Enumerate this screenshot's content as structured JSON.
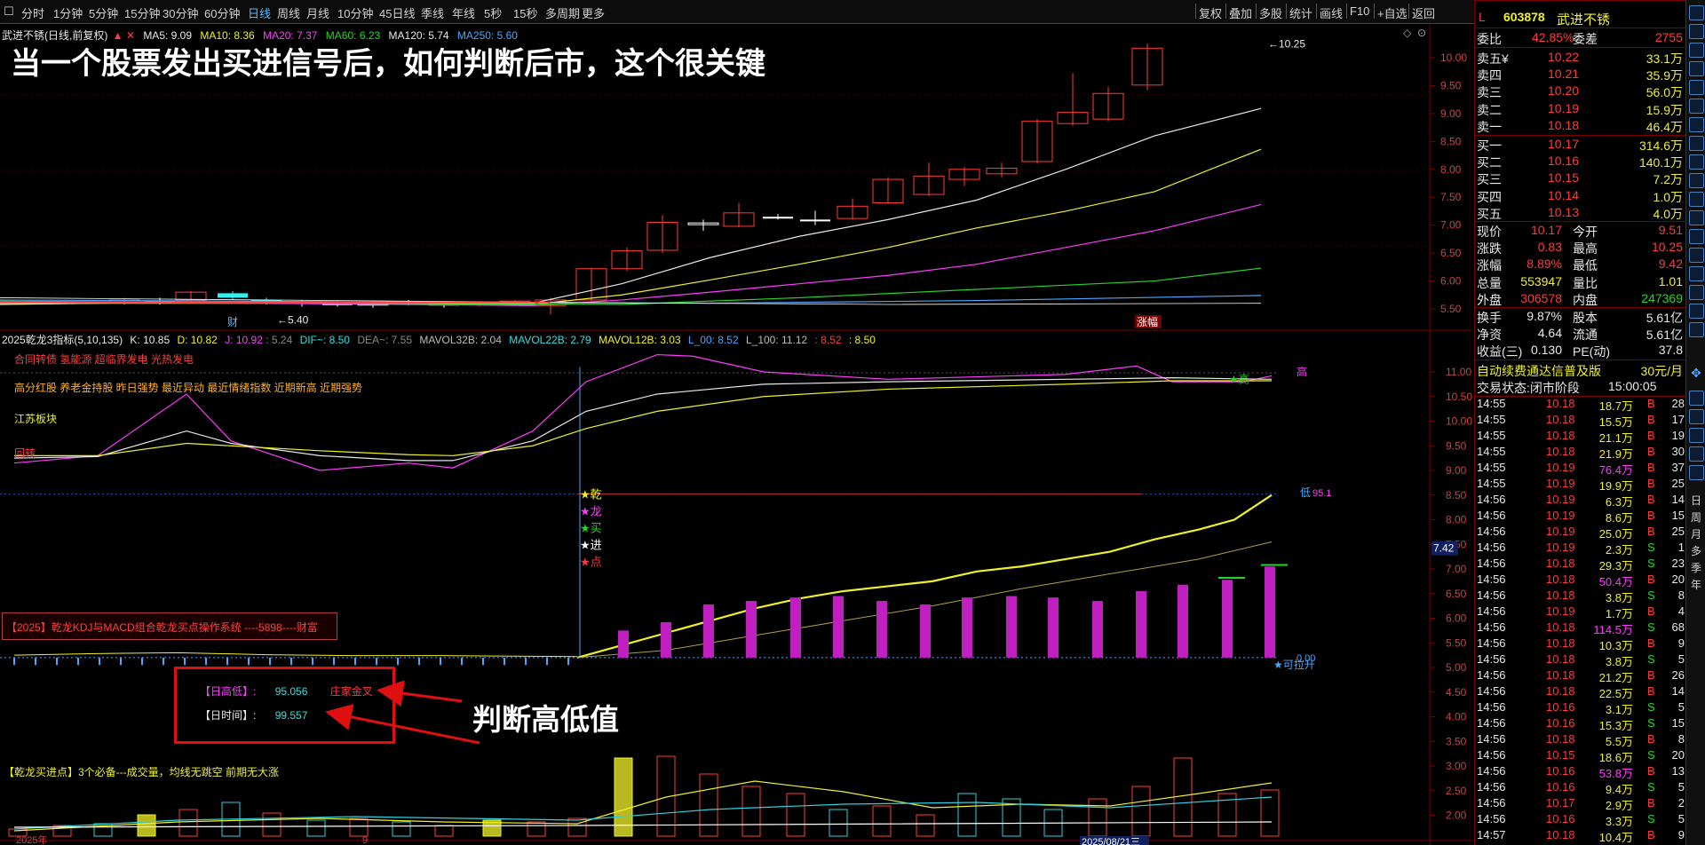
{
  "toolbar": {
    "periods": [
      "分时",
      "1分钟",
      "5分钟",
      "15分钟",
      "30分钟",
      "60分钟",
      "日线",
      "周线",
      "月线",
      "10分钟",
      "45日线",
      "季线",
      "年线",
      "5秒",
      "15秒",
      "多周期",
      "更多"
    ],
    "active_period": "日线",
    "right_buttons": [
      "复权",
      "叠加",
      "多股",
      "统计",
      "画线",
      "F10",
      "+自选",
      "返回"
    ]
  },
  "chart_header": {
    "stock_name": "武进不锈(日线,前复权)",
    "ma5": "MA5: 9.09",
    "ma10": "MA10: 8.36",
    "ma20": "MA20: 7.37",
    "ma60": "MA60: 6.23",
    "ma120": "MA120: 5.74",
    "ma250": "MA250: 5.60"
  },
  "headline": "当一个股票发出买进信号后，如何判断后市，这个很关键",
  "price_chart": {
    "high_label": "10.25",
    "low_label": "5.40",
    "markers": [
      "财",
      "涨幅"
    ],
    "y_ticks": [
      "10.00",
      "9.50",
      "9.00",
      "8.50",
      "8.00",
      "7.50",
      "7.00",
      "6.50",
      "6.00",
      "5.50"
    ]
  },
  "indicator_header": {
    "name": "2025乾龙3指标(5,10,135)",
    "k": "K: 10.85",
    "d": "D: 10.82",
    "j": "J: 10.92",
    "v1": ": 5.24",
    "dif": "DIF~: 8.50",
    "dea": "DEA~: 7.55",
    "mavol32b": "MAVOL32B: 2.04",
    "mavol22b": "MAVOL22B: 2.79",
    "mavol12b": "MAVOL12B: 3.03",
    "l00": "L_00: 8.52",
    "l100": "L_100: 11.12",
    "v2": ": 8.52",
    "v3": ": 8.50"
  },
  "indicator_texts": {
    "concepts1": "合同转债 氢能源 超临界发电 光热发电",
    "concepts2": "高分红股 养老金持股 昨日强势 最近异动 最近情绪指数 近期新高 近期强势",
    "region": "江苏板块",
    "tag": "回转",
    "high_tag": "高",
    "low_tag": "低",
    "low_val": "95.1",
    "star_high": "★高",
    "signals": [
      "★乾",
      "★龙",
      "★买",
      "★进",
      "★点"
    ],
    "system_box": "【2025】乾龙KDJ与MACD组合乾龙买点操作系统   ----5898----财富",
    "zero_label": "0.00",
    "can_pull": "★可拉升",
    "current_tag": "7.42"
  },
  "info_box": {
    "line1_label": "【日高低】:",
    "line1_value": "95.056",
    "line1_tag": "庄家金叉",
    "line2_label": "【日时间】:",
    "line2_value": "99.557"
  },
  "annotation": "判断高低值",
  "volume_panel": {
    "title": "【乾龙买进点】3个必备---成交量，均线无跳空 前期无大涨"
  },
  "indicator_y_ticks": [
    "11.00",
    "10.50",
    "10.00",
    "9.50",
    "9.00",
    "8.50",
    "8.00",
    "7.50",
    "7.00",
    "6.50",
    "6.00",
    "5.50",
    "5.00",
    "4.50",
    "4.00",
    "3.50",
    "3.00",
    "2.50",
    "2.00"
  ],
  "bottom_axis": [
    "2025年",
    "9",
    "2025/08/21三"
  ],
  "quote": {
    "flag": "L",
    "code": "603878",
    "name": "武进不锈",
    "weibi_label": "委比",
    "weibi": "42.85%",
    "weicha_label": "委差",
    "weicha": "2755",
    "sells": [
      {
        "label": "卖五¥",
        "price": "10.22",
        "vol": "33.1万"
      },
      {
        "label": "卖四",
        "price": "10.21",
        "vol": "35.9万"
      },
      {
        "label": "卖三",
        "price": "10.20",
        "vol": "56.0万"
      },
      {
        "label": "卖二",
        "price": "10.19",
        "vol": "15.9万"
      },
      {
        "label": "卖一",
        "price": "10.18",
        "vol": "46.4万"
      }
    ],
    "buys": [
      {
        "label": "买一",
        "price": "10.17",
        "vol": "314.6万"
      },
      {
        "label": "买二",
        "price": "10.16",
        "vol": "140.1万"
      },
      {
        "label": "买三",
        "price": "10.15",
        "vol": "7.2万"
      },
      {
        "label": "买四",
        "price": "10.14",
        "vol": "1.0万"
      },
      {
        "label": "买五",
        "price": "10.13",
        "vol": "4.0万"
      }
    ],
    "stats": [
      {
        "l1": "现价",
        "v1": "10.17",
        "l2": "今开",
        "v2": "9.51",
        "c1": "red",
        "c2": "red"
      },
      {
        "l1": "涨跌",
        "v1": "0.83",
        "l2": "最高",
        "v2": "10.25",
        "c1": "red",
        "c2": "red"
      },
      {
        "l1": "涨幅",
        "v1": "8.89%",
        "l2": "最低",
        "v2": "9.42",
        "c1": "red",
        "c2": "red"
      },
      {
        "l1": "总量",
        "v1": "553947",
        "l2": "量比",
        "v2": "1.01",
        "c1": "yellow",
        "c2": "yellow"
      },
      {
        "l1": "外盘",
        "v1": "306578",
        "l2": "内盘",
        "v2": "247369",
        "c1": "red",
        "c2": "green"
      }
    ],
    "stats2": [
      {
        "l1": "换手",
        "v1": "9.87%",
        "l2": "股本",
        "v2": "5.61亿"
      },
      {
        "l1": "净资",
        "v1": "4.64",
        "l2": "流通",
        "v2": "5.61亿"
      },
      {
        "l1": "收益(三)",
        "v1": "0.130",
        "l2": "PE(动)",
        "v2": "37.8"
      }
    ],
    "promo": "自动续费通达信普及版",
    "promo_price": "30元/月",
    "trade_status": "交易状态:闭市阶段",
    "trade_time": "15:00:05"
  },
  "ticks": [
    [
      "14:55",
      "10.18",
      "18.7万",
      "B",
      "28"
    ],
    [
      "14:55",
      "10.18",
      "15.5万",
      "B",
      "17"
    ],
    [
      "14:55",
      "10.18",
      "21.1万",
      "B",
      "19"
    ],
    [
      "14:55",
      "10.18",
      "21.9万",
      "B",
      "30"
    ],
    [
      "14:55",
      "10.19",
      "76.4万",
      "B",
      "37"
    ],
    [
      "14:55",
      "10.19",
      "19.9万",
      "B",
      "25"
    ],
    [
      "14:56",
      "10.19",
      "6.3万",
      "B",
      "14"
    ],
    [
      "14:56",
      "10.19",
      "8.6万",
      "B",
      "15"
    ],
    [
      "14:56",
      "10.19",
      "25.0万",
      "B",
      "25"
    ],
    [
      "14:56",
      "10.19",
      "2.3万",
      "S",
      "1"
    ],
    [
      "14:56",
      "10.18",
      "29.3万",
      "S",
      "23"
    ],
    [
      "14:56",
      "10.18",
      "50.4万",
      "B",
      "20"
    ],
    [
      "14:56",
      "10.18",
      "3.8万",
      "S",
      "8"
    ],
    [
      "14:56",
      "10.19",
      "1.7万",
      "B",
      "4"
    ],
    [
      "14:56",
      "10.18",
      "114.5万",
      "S",
      "68"
    ],
    [
      "14:56",
      "10.18",
      "10.3万",
      "B",
      "9"
    ],
    [
      "14:56",
      "10.18",
      "3.8万",
      "S",
      "5"
    ],
    [
      "14:56",
      "10.18",
      "21.2万",
      "B",
      "26"
    ],
    [
      "14:56",
      "10.18",
      "22.5万",
      "B",
      "14"
    ],
    [
      "14:56",
      "10.16",
      "3.1万",
      "S",
      "5"
    ],
    [
      "14:56",
      "10.16",
      "15.3万",
      "S",
      "15"
    ],
    [
      "14:56",
      "10.18",
      "5.5万",
      "B",
      "8"
    ],
    [
      "14:56",
      "10.15",
      "18.6万",
      "S",
      "20"
    ],
    [
      "14:56",
      "10.16",
      "53.8万",
      "B",
      "13"
    ],
    [
      "14:56",
      "10.16",
      "9.4万",
      "S",
      "5"
    ],
    [
      "14:56",
      "10.17",
      "2.9万",
      "B",
      "2"
    ],
    [
      "14:56",
      "10.16",
      "3.3万",
      "S",
      "5"
    ],
    [
      "14:57",
      "10.18",
      "10.4万",
      "B",
      "9"
    ]
  ],
  "tool_labels": [
    "日",
    "周",
    "月",
    "多",
    "季",
    "年"
  ],
  "colors": {
    "up": "#ff3b3b",
    "down": "#28d428",
    "panel_border": "#7a0000",
    "active": "#5cb7ff"
  }
}
